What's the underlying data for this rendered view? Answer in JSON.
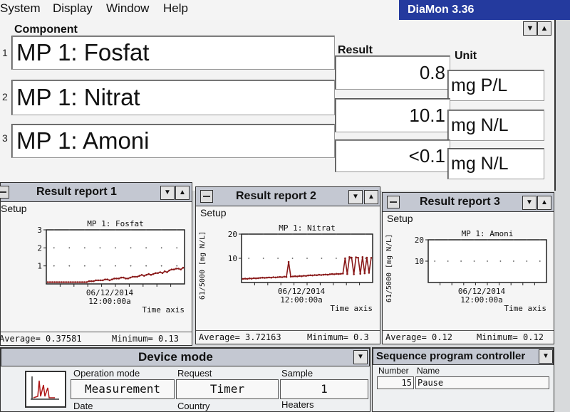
{
  "menu": [
    "System",
    "Display",
    "Window",
    "Help"
  ],
  "app_title": "DiaMon 3.36",
  "main": {
    "col_component": "Component",
    "col_result": "Result",
    "col_unit": "Unit",
    "rows": [
      {
        "num": "1",
        "component": "MP 1: Fosfat",
        "result": "0.8",
        "unit": "mg P/L"
      },
      {
        "num": "2",
        "component": "MP 1: Nitrat",
        "result": "10.1",
        "unit": "mg N/L"
      },
      {
        "num": "3",
        "component": "MP 1: Amoni",
        "result": "<0.1",
        "unit": "mg N/L"
      }
    ]
  },
  "reports": [
    {
      "title": "Result report 1",
      "setup": "Setup",
      "status_avg": "Average= 0.37581",
      "status_min": "Minimum= 0.13",
      "chart_data": {
        "type": "line",
        "title": "MP 1: Fosfat",
        "ylabel": "",
        "ylim": [
          0,
          3
        ],
        "yticks": [
          "1",
          "2",
          "3"
        ],
        "xlabel": "Time axis",
        "date": "06/12/2014",
        "time": "12:00:00a",
        "values": [
          0.1,
          0.1,
          0.1,
          0.1,
          0.1,
          0.1,
          0.1,
          0.1,
          0.1,
          0.1,
          0.1,
          0.1,
          0.1,
          0.1,
          0.1,
          0.1,
          0.1,
          0.1,
          0.15,
          0.15,
          0.15,
          0.2,
          0.2,
          0.2,
          0.2,
          0.25,
          0.25,
          0.2,
          0.25,
          0.3,
          0.3,
          0.3,
          0.35,
          0.35,
          0.3,
          0.3,
          0.35,
          0.4,
          0.4,
          0.4,
          0.45,
          0.5,
          0.45,
          0.5,
          0.55,
          0.5,
          0.55,
          0.6,
          0.6,
          0.65,
          0.6,
          0.7,
          0.65,
          0.75,
          0.8,
          0.8,
          0.85,
          0.85,
          0.8,
          0.9
        ]
      }
    },
    {
      "title": "Result report 2",
      "setup": "Setup",
      "status_avg": "Average= 3.72163",
      "status_min": "Minimum= 0.3",
      "chart_data": {
        "type": "line",
        "title": "MP 1: Nitrat",
        "ylabel": "61/5000 [mg N/L]",
        "ylim": [
          0,
          20
        ],
        "yticks": [
          "10",
          "20"
        ],
        "xlabel": "Time axis",
        "date": "06/12/2014",
        "time": "12:00:00a",
        "values": [
          1.5,
          1.6,
          1.5,
          1.7,
          1.6,
          1.8,
          1.7,
          1.8,
          1.9,
          2.0,
          1.9,
          2.0,
          2.1,
          2.0,
          2.2,
          2.1,
          2.2,
          2.3,
          2.2,
          2.4,
          2.3,
          8.5,
          2.4,
          2.5,
          2.6,
          2.5,
          2.7,
          2.6,
          2.8,
          2.7,
          2.9,
          3.0,
          2.9,
          3.1,
          3.0,
          3.2,
          3.1,
          3.2,
          3.3,
          3.2,
          3.4,
          3.5,
          3.4,
          3.6,
          3.5,
          3.6,
          3.7,
          10.0,
          3.5,
          10.5,
          10.3,
          3.4,
          10.4,
          10.2,
          3.6,
          10.5,
          3.8,
          10.3,
          4.0,
          10.2
        ]
      }
    },
    {
      "title": "Result report 3",
      "setup": "Setup",
      "status_avg": "Average= 0.12",
      "status_min": "Minimum= 0.12",
      "chart_data": {
        "type": "line",
        "title": "MP 1: Amoni",
        "ylabel": "61/5000 [mg N/L]",
        "ylim": [
          0,
          20
        ],
        "yticks": [
          "10",
          "20"
        ],
        "xlabel": "Time axis",
        "date": "06/12/2014",
        "time": "12:00:00a",
        "values": []
      }
    }
  ],
  "device": {
    "title": "Device mode",
    "labels": {
      "op_mode": "Operation mode",
      "request": "Request",
      "sample": "Sample",
      "date": "Date",
      "country": "Country",
      "heaters": "Heaters"
    },
    "values": {
      "op_mode": "Measurement",
      "request": "Timer",
      "sample": "1"
    }
  },
  "sequence": {
    "title": "Sequence program controller",
    "labels": {
      "number": "Number",
      "name": "Name"
    },
    "values": {
      "number": "15",
      "name": "Pause"
    }
  }
}
